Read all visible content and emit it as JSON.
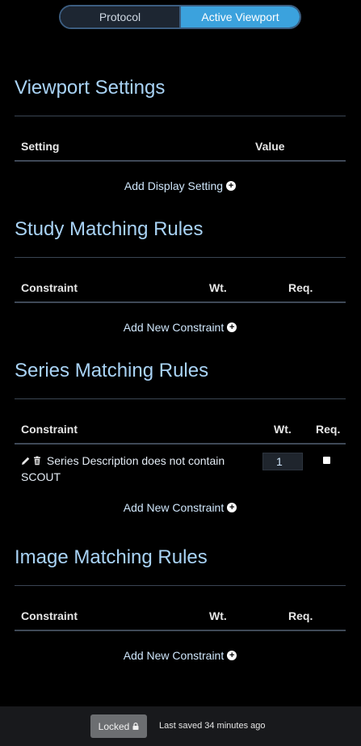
{
  "tabs": {
    "protocol": "Protocol",
    "active_viewport": "Active Viewport"
  },
  "viewport_settings": {
    "title": "Viewport Settings",
    "col_setting": "Setting",
    "col_value": "Value",
    "add_label": "Add Display Setting"
  },
  "study_rules": {
    "title": "Study Matching Rules",
    "col_constraint": "Constraint",
    "col_wt": "Wt.",
    "col_req": "Req.",
    "add_label": "Add New Constraint"
  },
  "series_rules": {
    "title": "Series Matching Rules",
    "col_constraint": "Constraint",
    "col_wt": "Wt.",
    "col_req": "Req.",
    "rows": [
      {
        "description": "Series Description does not contain SCOUT",
        "weight": "1",
        "required": false
      }
    ],
    "add_label": "Add New Constraint"
  },
  "image_rules": {
    "title": "Image Matching Rules",
    "col_constraint": "Constraint",
    "col_wt": "Wt.",
    "col_req": "Req.",
    "add_label": "Add New Constraint"
  },
  "footer": {
    "locked_label": "Locked",
    "status": "Last saved 34 minutes ago"
  }
}
